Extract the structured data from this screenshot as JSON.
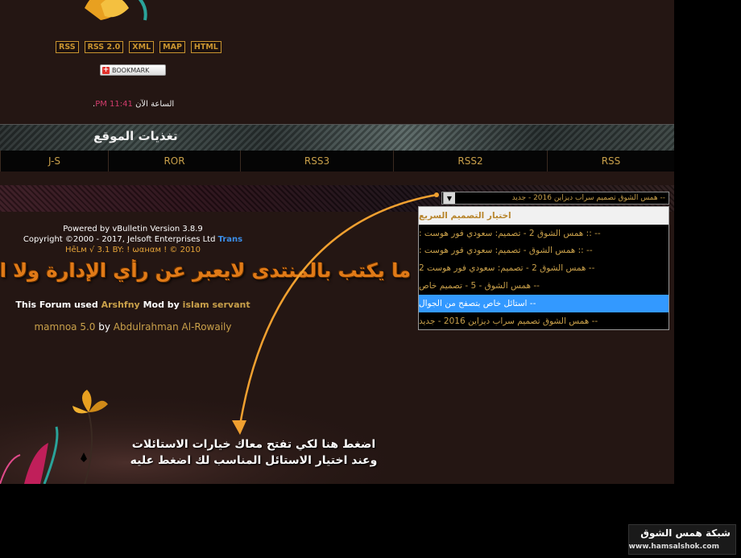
{
  "badges": [
    "RSS",
    "RSS 2.0",
    "XML",
    "MAP",
    "HTML"
  ],
  "bookmark_label": "BOOKMARK",
  "time": {
    "label": "الساعة الآن",
    "value": "11:41 PM",
    "suffix": "."
  },
  "feeds": {
    "title": "تغذيات الموقع",
    "items": [
      "J-S",
      "ROR",
      "RSS3",
      "RSS2",
      "RSS"
    ]
  },
  "style_select": {
    "selected_value": "-- همس الشوق تصميم سراب ديزاين 2016 - جديد",
    "options": [
      "اختيار التصميم السريع",
      "-- :: همس الشوق 2 - تصميم: سعودي فور هوست :",
      "-- :: همس الشوق - تصميم: سعودي فور هوست :",
      "-- همس الشوق 2 - تصميم: سعودي فور هوست 2",
      "-- همس الشوق - 5 - تصميم خاص",
      "-- استائل خاص بتصفح من الجوال",
      "-- همس الشوق تصميم سراب ديزاين 2016 - جديد"
    ],
    "highlighted_index": 5
  },
  "footer": {
    "powered_by": "Powered by vBulletin Version 3.8.9",
    "copyright": "Copyright ©2000 - 2017, Jelsoft Enterprises Ltd",
    "trans": "Trans",
    "hack_line": "HēLм √ 3.1 BY: ! ωαнαм ! © 2010",
    "disclaimer": "ما يكتب بالمنتدى لايعبر عن رأي الإدارة ولا الأعضاء",
    "forum_used_prefix": "This Forum used",
    "forum_used_mod": "Arshfny",
    "forum_used_mid": "Mod by",
    "forum_used_author": "islam servant",
    "mamnoa_product": "mamnoa 5.0",
    "mamnoa_by": "by",
    "mamnoa_author": "Abdulrahman Al-Rowaily"
  },
  "hint": {
    "line1": "اضغط هنا لكي تفتح معاك خيارات الاستائلات",
    "line2": "وعند اختيار الاستائل المناسب لك اضغط عليه"
  },
  "watermark": {
    "title": "شبكة همس الشوق",
    "url": "www.hamsalshok.com"
  },
  "colors": {
    "accent_gold": "#c9a04a",
    "highlight_blue": "#3399ff",
    "arrow_orange": "#f0a030",
    "page_bg": "#241613"
  }
}
